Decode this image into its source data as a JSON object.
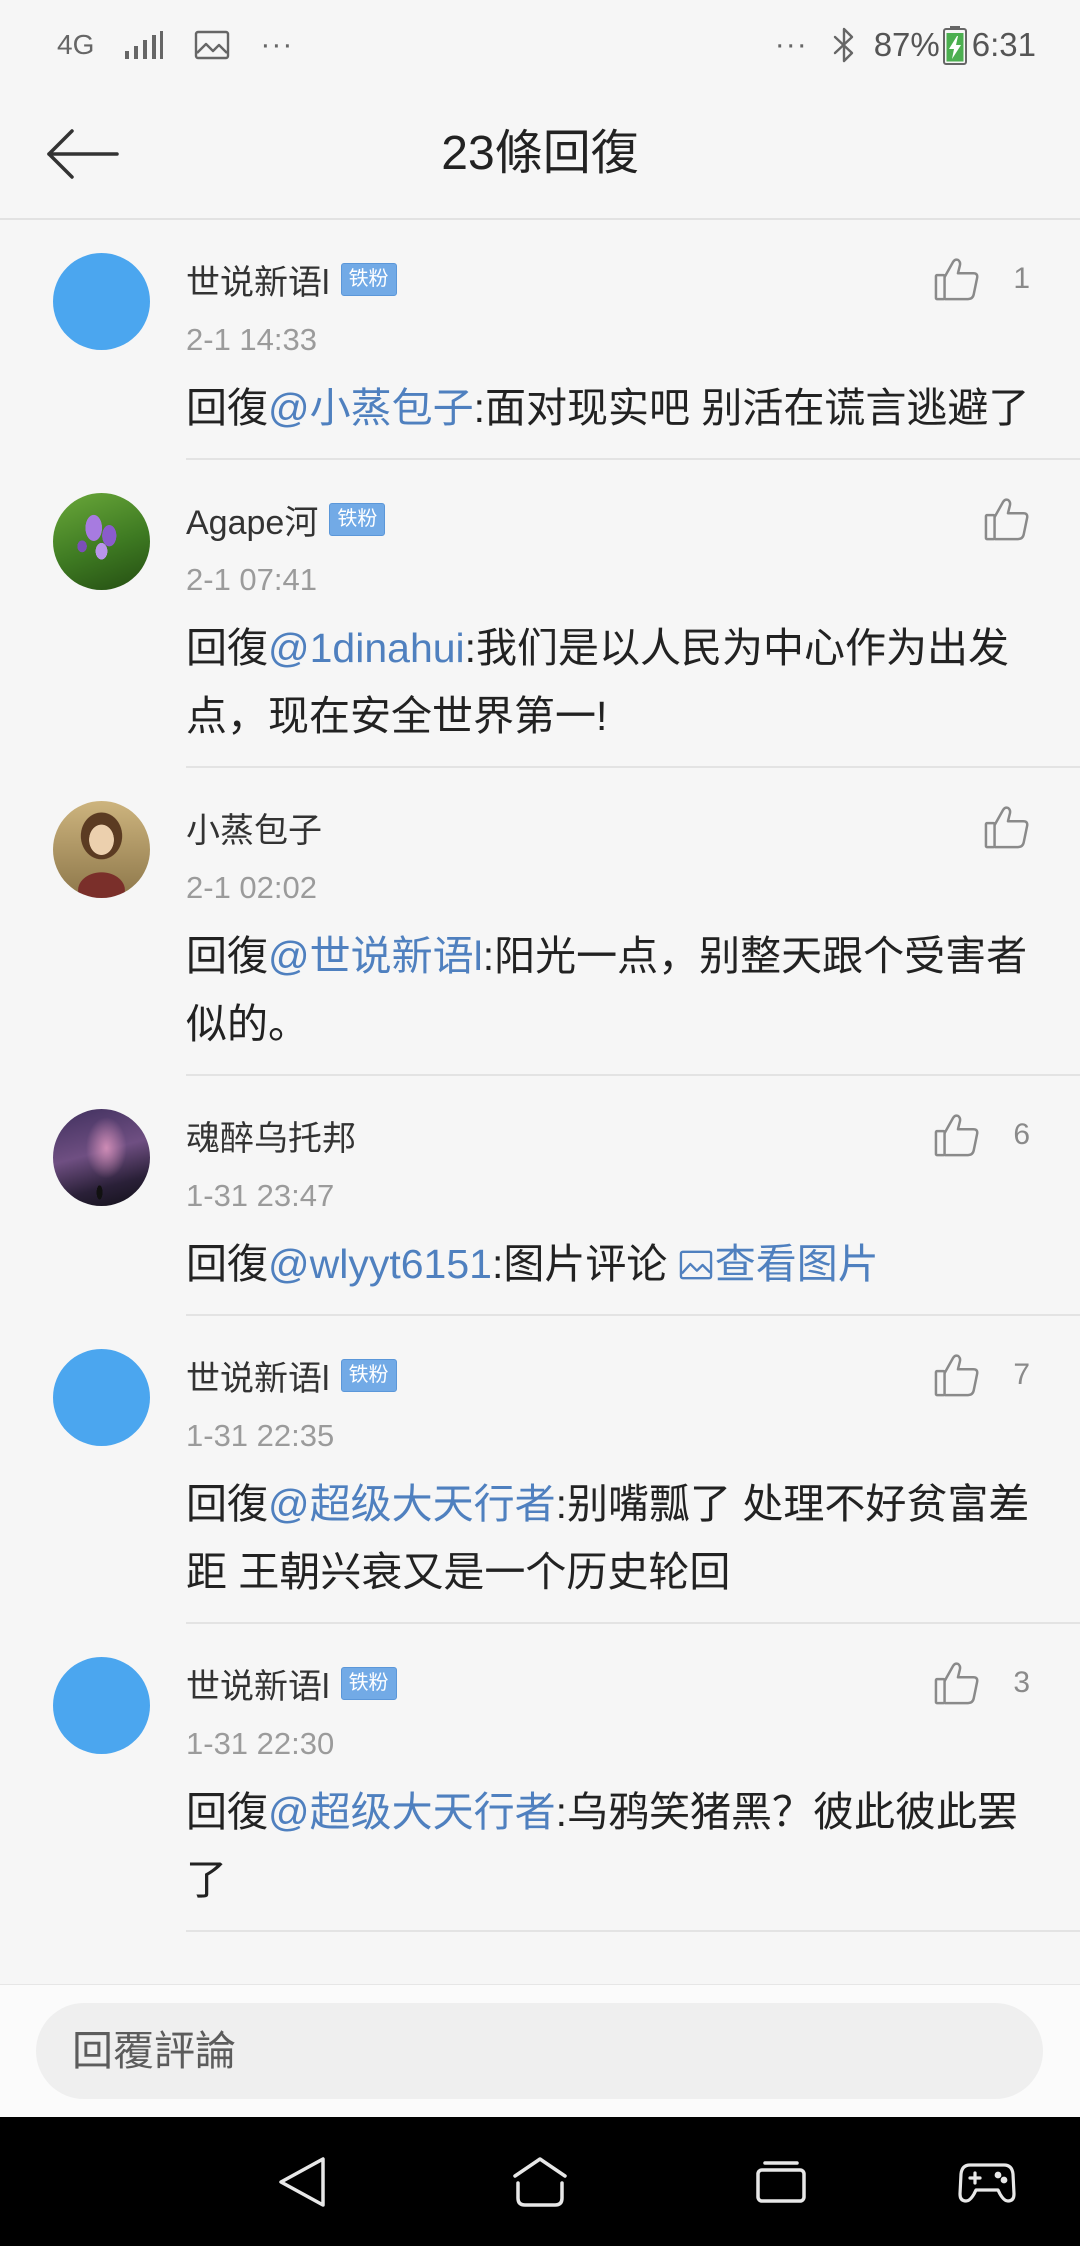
{
  "status_bar": {
    "network": "4G",
    "overflow_left": "···",
    "overflow_right": "···",
    "battery": "87%",
    "time": "6:31",
    "icons": [
      "signal-icon",
      "image-icon",
      "bluetooth-icon",
      "battery-charging-icon"
    ]
  },
  "header": {
    "title": "23條回復",
    "back_icon": "arrow-left-icon"
  },
  "comments": [
    {
      "avatar": "default-blue",
      "name": "世说新语l",
      "badge": "铁粉",
      "date": "2-1 14:33",
      "likes": "1",
      "reply_prefix": "回復",
      "mention": "@小蒸包子",
      "body": ":面对现实吧 别活在谎言逃避了"
    },
    {
      "avatar": "iris-flower-photo",
      "name": "Agape河",
      "badge": "铁粉",
      "date": "2-1 07:41",
      "reply_prefix": "回復",
      "mention": "@1dinahui",
      "body": ":我们是以人民为中心作为出发点，现在安全世界第一!"
    },
    {
      "avatar": "portrait-painting",
      "name": "小蒸包子",
      "date": "2-1 02:02",
      "reply_prefix": "回復",
      "mention": "@世说新语l",
      "body": ":阳光一点，别整天跟个受害者似的。"
    },
    {
      "avatar": "night-sky-photo",
      "name": "魂醉乌托邦",
      "date": "1-31 23:47",
      "likes": "6",
      "reply_prefix": "回復",
      "mention": "@wlyyt6151",
      "body": ":图片评论 ",
      "image_link": "查看图片"
    },
    {
      "avatar": "default-blue",
      "name": "世说新语l",
      "badge": "铁粉",
      "date": "1-31 22:35",
      "likes": "7",
      "reply_prefix": "回復",
      "mention": "@超级大天行者",
      "body": ":别嘴瓢了 处理不好贫富差距 王朝兴衰又是一个历史轮回"
    },
    {
      "avatar": "default-blue",
      "name": "世说新语l",
      "badge": "铁粉",
      "date": "1-31 22:30",
      "likes": "3",
      "reply_prefix": "回復",
      "mention": "@超级大天行者",
      "body": ":乌鸦笑猪黑？彼此彼此罢了"
    }
  ],
  "reply_bar": {
    "placeholder": "回覆評論"
  },
  "nav_bar": {
    "icons": [
      "back-triangle-icon",
      "home-icon",
      "recents-icon",
      "game-controller-icon"
    ]
  },
  "colors": {
    "link": "#4f80bf",
    "badge": "#72aae6",
    "default_avatar": "#4ba6ef",
    "battery_fill": "#4caf50",
    "nav_bar_bg": "#000000"
  }
}
